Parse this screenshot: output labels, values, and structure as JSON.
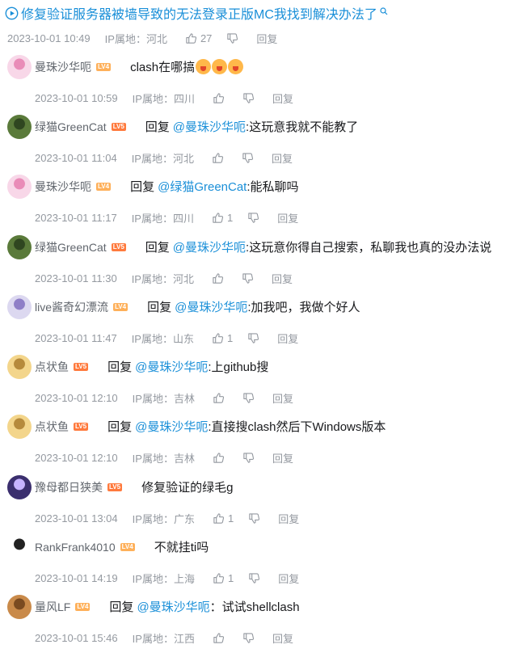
{
  "header": {
    "title": "修复验证服务器被墙导致的无法登录正版MC我找到解决办法了",
    "time": "2023-10-01 10:49",
    "ip": "IP属地：河北",
    "likes": "27",
    "reply": "回复"
  },
  "comments": [
    {
      "user": "曼珠沙华呃",
      "level": "LV4",
      "reply_word": "",
      "at": "",
      "text": "clash在哪搞",
      "time": "2023-10-01 10:59",
      "ip": "IP属地：四川",
      "likes": "",
      "reply": "回复",
      "emoji": "crying-emoji"
    },
    {
      "user": "绿猫GreenCat",
      "level": "LV5",
      "reply_word": "回复",
      "at": "@曼珠沙华呃",
      "text": ":这玩意我就不能教了",
      "time": "2023-10-01 11:04",
      "ip": "IP属地：河北",
      "likes": "",
      "reply": "回复"
    },
    {
      "user": "曼珠沙华呃",
      "level": "LV4",
      "reply_word": "回复",
      "at": "@绿猫GreenCat",
      "text": ":能私聊吗",
      "time": "2023-10-01 11:17",
      "ip": "IP属地：四川",
      "likes": "1",
      "reply": "回复"
    },
    {
      "user": "绿猫GreenCat",
      "level": "LV5",
      "reply_word": "回复",
      "at": "@曼珠沙华呃",
      "text": ":这玩意你得自己搜索，私聊我也真的没办法说",
      "time": "2023-10-01 11:30",
      "ip": "IP属地：河北",
      "likes": "",
      "reply": "回复"
    },
    {
      "user": "live酱奇幻漂流",
      "level": "LV4",
      "reply_word": "回复",
      "at": "@曼珠沙华呃",
      "text": ":加我吧，我做个好人",
      "time": "2023-10-01 11:47",
      "ip": "IP属地：山东",
      "likes": "1",
      "reply": "回复"
    },
    {
      "user": "点状鱼",
      "level": "LV5",
      "reply_word": "回复",
      "at": "@曼珠沙华呃",
      "text": ":上github搜",
      "time": "2023-10-01 12:10",
      "ip": "IP属地：吉林",
      "likes": "",
      "reply": "回复"
    },
    {
      "user": "点状鱼",
      "level": "LV5",
      "reply_word": "回复",
      "at": "@曼珠沙华呃",
      "text": ":直接搜clash然后下Windows版本",
      "time": "2023-10-01 12:10",
      "ip": "IP属地：吉林",
      "likes": "",
      "reply": "回复"
    },
    {
      "user": "豫母都日狭美",
      "level": "LV5",
      "reply_word": "",
      "at": "",
      "text": "修复验证的绿毛g",
      "time": "2023-10-01 13:04",
      "ip": "IP属地：广东",
      "likes": "1",
      "reply": "回复"
    },
    {
      "user": "RankFrank4010",
      "level": "LV4",
      "reply_word": "",
      "at": "",
      "text": "不就挂ti吗",
      "time": "2023-10-01 14:19",
      "ip": "IP属地：上海",
      "likes": "1",
      "reply": "回复"
    },
    {
      "user": "量风LF",
      "level": "LV4",
      "reply_word": "回复",
      "at": "@曼珠沙华呃",
      "text": "：试试shellclash",
      "time": "2023-10-01 15:46",
      "ip": "IP属地：江西",
      "likes": "",
      "reply": "回复"
    }
  ],
  "colors": {
    "link": "#1a8fd8",
    "meta": "#9499a0",
    "lv4": "#feb05a",
    "lv5": "#ff7a3d"
  },
  "icons": {
    "play": "play-circle-icon",
    "search": "search-icon",
    "like": "thumbs-up-icon",
    "dislike": "thumbs-down-icon"
  }
}
